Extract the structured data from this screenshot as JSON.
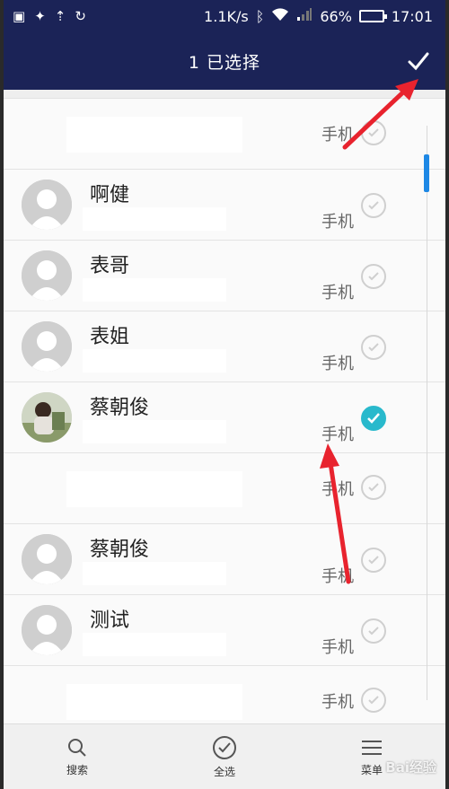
{
  "statusbar": {
    "speed": "1.1K/s",
    "battery": "66%",
    "battery_level": 0.66,
    "time": "17:01"
  },
  "header": {
    "title": "1 已选择",
    "confirm_icon": "check-icon"
  },
  "contacts": [
    {
      "name": "",
      "label": "手机",
      "has_avatar": false,
      "selected": false
    },
    {
      "name": "啊健",
      "label": "手机",
      "has_avatar": true,
      "selected": false
    },
    {
      "name": "表哥",
      "label": "手机",
      "has_avatar": true,
      "selected": false
    },
    {
      "name": "表姐",
      "label": "手机",
      "has_avatar": true,
      "selected": false
    },
    {
      "name": "蔡朝俊",
      "label": "手机",
      "has_avatar": true,
      "photo": true,
      "selected": true
    },
    {
      "name": "",
      "label": "手机",
      "has_avatar": false,
      "selected": false
    },
    {
      "name": "蔡朝俊",
      "label": "手机",
      "has_avatar": true,
      "selected": false
    },
    {
      "name": "测试",
      "label": "手机",
      "has_avatar": true,
      "selected": false
    },
    {
      "name": "",
      "label": "手机",
      "has_avatar": false,
      "selected": false
    }
  ],
  "bottom": {
    "search": "搜索",
    "select_all": "全选",
    "menu": "菜单"
  },
  "watermark": "Bai经验",
  "colors": {
    "header": "#1b2357",
    "accent": "#29b9cc",
    "arrow": "#e8232e"
  }
}
